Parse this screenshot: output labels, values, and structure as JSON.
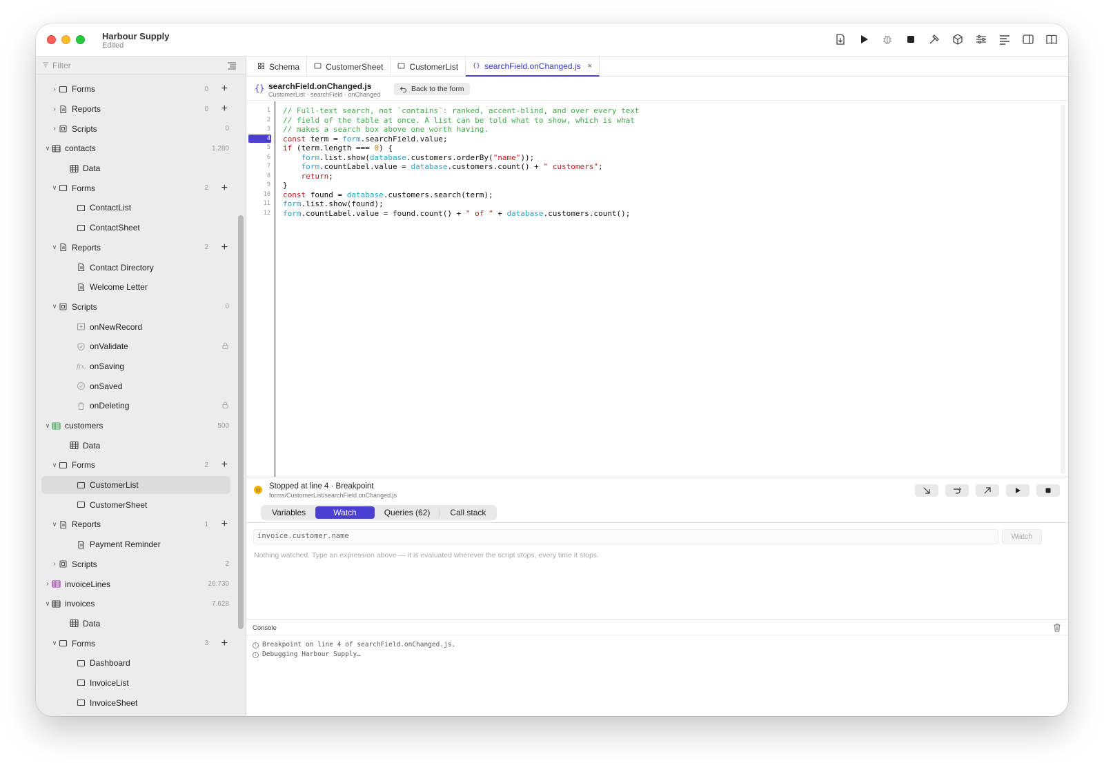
{
  "app": {
    "title": "Harbour Supply",
    "status": "Edited"
  },
  "toolbar": {
    "icons": [
      "export-icon",
      "run-icon",
      "debug-icon",
      "stop-icon",
      "build-icon",
      "package-icon",
      "settings-icon",
      "format-icon",
      "panel-icon",
      "docs-icon"
    ]
  },
  "sidebar": {
    "filter_placeholder": "Filter",
    "rows": [
      {
        "label": "Forms",
        "level": 1,
        "chev": "›",
        "icon": "form",
        "count": "0",
        "plus": true
      },
      {
        "label": "Reports",
        "level": 1,
        "chev": "›",
        "icon": "report",
        "count": "0",
        "plus": true
      },
      {
        "label": "Scripts",
        "level": 1,
        "chev": "›",
        "icon": "script",
        "count": "0",
        "plus": false
      },
      {
        "label": "contacts",
        "level": 0,
        "chev": "⌄",
        "icon": "table",
        "count": "1.280",
        "plus": false
      },
      {
        "label": "Data",
        "level": 2,
        "chev": "",
        "icon": "data",
        "count": "",
        "plus": false
      },
      {
        "label": "Forms",
        "level": 1,
        "chev": "⌄",
        "icon": "form",
        "count": "2",
        "plus": true
      },
      {
        "label": "ContactList",
        "level": 3,
        "chev": "",
        "icon": "form",
        "count": "",
        "plus": false
      },
      {
        "label": "ContactSheet",
        "level": 3,
        "chev": "",
        "icon": "form",
        "count": "",
        "plus": false
      },
      {
        "label": "Reports",
        "level": 1,
        "chev": "⌄",
        "icon": "report",
        "count": "2",
        "plus": true
      },
      {
        "label": "Contact Directory",
        "level": 3,
        "chev": "",
        "icon": "report",
        "count": "",
        "plus": false
      },
      {
        "label": "Welcome Letter",
        "level": 3,
        "chev": "",
        "icon": "report",
        "count": "",
        "plus": false
      },
      {
        "label": "Scripts",
        "level": 1,
        "chev": "⌄",
        "icon": "script",
        "count": "0",
        "plus": false
      },
      {
        "label": "onNewRecord",
        "level": 3,
        "chev": "",
        "icon": "newrecord",
        "count": "",
        "plus": false
      },
      {
        "label": "onValidate",
        "level": 3,
        "chev": "",
        "icon": "validate",
        "count": "",
        "plus": false,
        "lock": true
      },
      {
        "label": "onSaving",
        "level": 3,
        "chev": "",
        "icon": "fx",
        "count": "",
        "plus": false
      },
      {
        "label": "onSaved",
        "level": 3,
        "chev": "",
        "icon": "check",
        "count": "",
        "plus": false
      },
      {
        "label": "onDeleting",
        "level": 3,
        "chev": "",
        "icon": "trash",
        "count": "",
        "plus": false,
        "lock": true
      },
      {
        "label": "customers",
        "level": 0,
        "chev": "⌄",
        "icon": "table-green",
        "count": "500",
        "plus": false
      },
      {
        "label": "Data",
        "level": 2,
        "chev": "",
        "icon": "data",
        "count": "",
        "plus": false
      },
      {
        "label": "Forms",
        "level": 1,
        "chev": "⌄",
        "icon": "form",
        "count": "2",
        "plus": true
      },
      {
        "label": "CustomerList",
        "level": 3,
        "chev": "",
        "icon": "form",
        "count": "",
        "plus": false,
        "selected": true
      },
      {
        "label": "CustomerSheet",
        "level": 3,
        "chev": "",
        "icon": "form",
        "count": "",
        "plus": false
      },
      {
        "label": "Reports",
        "level": 1,
        "chev": "⌄",
        "icon": "report",
        "count": "1",
        "plus": true
      },
      {
        "label": "Payment Reminder",
        "level": 3,
        "chev": "",
        "icon": "report",
        "count": "",
        "plus": false
      },
      {
        "label": "Scripts",
        "level": 1,
        "chev": "›",
        "icon": "script",
        "count": "2",
        "plus": false
      },
      {
        "label": "invoiceLines",
        "level": 0,
        "chev": "›",
        "icon": "table-purple",
        "count": "26.730",
        "plus": false
      },
      {
        "label": "invoices",
        "level": 0,
        "chev": "⌄",
        "icon": "table",
        "count": "7.628",
        "plus": false
      },
      {
        "label": "Data",
        "level": 2,
        "chev": "",
        "icon": "data",
        "count": "",
        "plus": false
      },
      {
        "label": "Forms",
        "level": 1,
        "chev": "⌄",
        "icon": "form",
        "count": "3",
        "plus": true
      },
      {
        "label": "Dashboard",
        "level": 3,
        "chev": "",
        "icon": "form",
        "count": "",
        "plus": false
      },
      {
        "label": "InvoiceList",
        "level": 3,
        "chev": "",
        "icon": "form",
        "count": "",
        "plus": false
      },
      {
        "label": "InvoiceSheet",
        "level": 3,
        "chev": "",
        "icon": "form",
        "count": "",
        "plus": false
      }
    ]
  },
  "tabs": [
    {
      "label": "Schema",
      "icon": "schema",
      "active": false
    },
    {
      "label": "CustomerSheet",
      "icon": "form",
      "active": false
    },
    {
      "label": "CustomerList",
      "icon": "form",
      "active": false
    },
    {
      "label": "searchField.onChanged.js",
      "icon": "braces",
      "active": true,
      "closable": true
    }
  ],
  "file": {
    "icon_glyph": "{}",
    "name": "searchField.onChanged.js",
    "path": "CustomerList · searchField · onChanged",
    "back_label": "Back to the form"
  },
  "editor": {
    "breakpoint_line": 4,
    "lines": [
      [
        [
          "c-cmt",
          "// Full-text search, not `contains`: ranked, accent-blind, and over every text"
        ]
      ],
      [
        [
          "c-cmt",
          "// field of the table at once. A list can be told what to show, which is what"
        ]
      ],
      [
        [
          "c-cmt",
          "// makes a search box above one worth having."
        ]
      ],
      [
        [
          "c-kw",
          "const"
        ],
        [
          "",
          " term = "
        ],
        [
          "c-obj",
          "form"
        ],
        [
          "",
          ".searchField.value;"
        ]
      ],
      [
        [
          "c-kw",
          "if"
        ],
        [
          "",
          " (term.length === "
        ],
        [
          "c-num",
          "0"
        ],
        [
          "",
          ") {"
        ]
      ],
      [
        [
          "",
          "    "
        ],
        [
          "c-obj",
          "form"
        ],
        [
          "",
          ".list.show("
        ],
        [
          "c-obj",
          "database"
        ],
        [
          "",
          ".customers.orderBy("
        ],
        [
          "c-str",
          "\"name\""
        ],
        [
          "",
          "));"
        ]
      ],
      [
        [
          "",
          "    "
        ],
        [
          "c-obj",
          "form"
        ],
        [
          "",
          ".countLabel.value = "
        ],
        [
          "c-obj",
          "database"
        ],
        [
          "",
          ".customers.count() + "
        ],
        [
          "c-str",
          "\" customers\""
        ],
        [
          "",
          ";"
        ]
      ],
      [
        [
          "",
          "    "
        ],
        [
          "c-kw",
          "return"
        ],
        [
          "",
          ";"
        ]
      ],
      [
        [
          "",
          "}"
        ]
      ],
      [
        [
          "c-kw",
          "const"
        ],
        [
          "",
          " found = "
        ],
        [
          "c-obj",
          "database"
        ],
        [
          "",
          ".customers.search(term);"
        ]
      ],
      [
        [
          "c-obj",
          "form"
        ],
        [
          "",
          ".list.show(found);"
        ]
      ],
      [
        [
          "c-obj",
          "form"
        ],
        [
          "",
          ".countLabel.value = found.count() + "
        ],
        [
          "c-str",
          "\" of \""
        ],
        [
          "",
          " + "
        ],
        [
          "c-obj",
          "database"
        ],
        [
          "",
          ".customers.count();"
        ]
      ]
    ]
  },
  "debug": {
    "status": "Stopped at line 4 · Breakpoint",
    "path": "forms/CustomerList/searchField.onChanged.js",
    "controls": [
      "step-into-icon",
      "step-over-icon",
      "step-out-icon",
      "continue-icon",
      "stop-icon"
    ]
  },
  "panel_tabs": {
    "variables": "Variables",
    "watch": "Watch",
    "queries": "Queries (62)",
    "callstack": "Call stack"
  },
  "watch": {
    "input_value": "invoice.customer.name",
    "button": "Watch",
    "empty_text": "Nothing watched. Type an expression above — it is evaluated wherever the script stops, every time it stops."
  },
  "console": {
    "title": "Console",
    "lines": [
      "Breakpoint on line 4 of searchField.onChanged.js.",
      "Debugging Harbour Supply…"
    ]
  },
  "colors": {
    "accent": "#4a3fd1",
    "comment": "#3fae49",
    "keyword": "#c21f1f",
    "object": "#2aa6c9"
  }
}
